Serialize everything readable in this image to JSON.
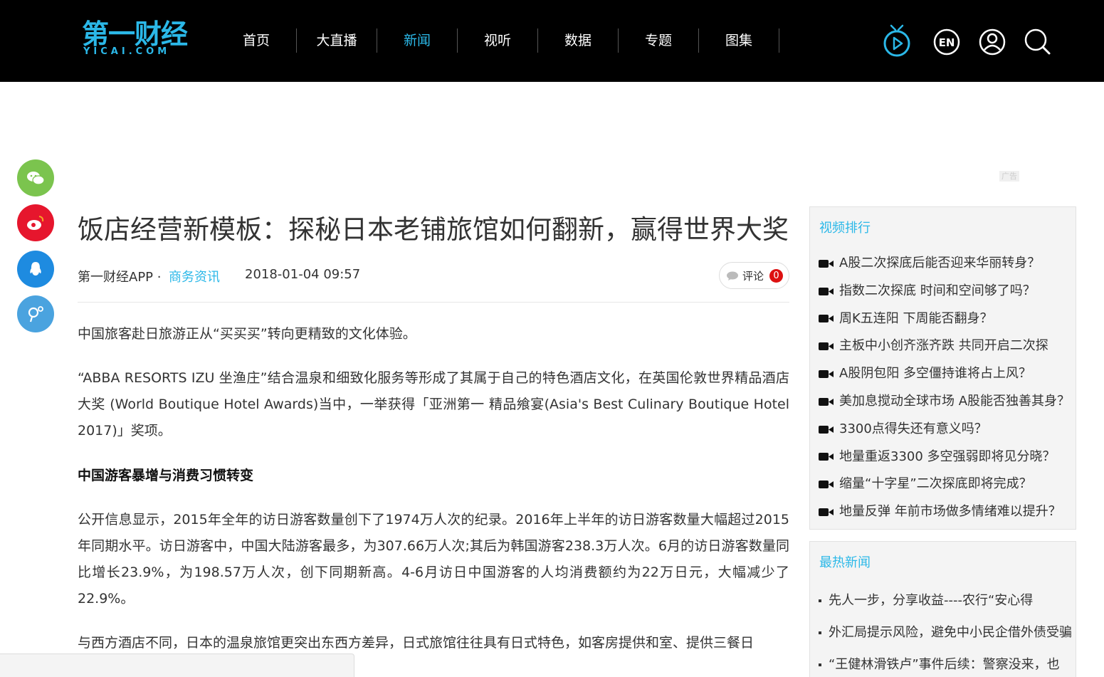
{
  "header": {
    "logo_cn": "第一财经",
    "logo_en": "YICAI.COM",
    "nav": [
      {
        "label": "首页",
        "active": false
      },
      {
        "label": "大直播",
        "active": false
      },
      {
        "label": "新闻",
        "active": true
      },
      {
        "label": "视听",
        "active": false
      },
      {
        "label": "数据",
        "active": false
      },
      {
        "label": "专题",
        "active": false
      },
      {
        "label": "图集",
        "active": false
      }
    ],
    "icons": [
      "tv-play-icon",
      "en-language-icon",
      "user-icon",
      "search-icon"
    ],
    "en_label": "EN"
  },
  "ad": {
    "tag": "广告"
  },
  "share": [
    {
      "name": "wechat-share-icon",
      "color": "#7bc44e"
    },
    {
      "name": "weibo-share-icon",
      "color": "#e6162d"
    },
    {
      "name": "qq-share-icon",
      "color": "#1e8be0"
    },
    {
      "name": "qzone-share-icon",
      "color": "#4aa3df"
    }
  ],
  "article": {
    "title": "饭店经营新模板：探秘日本老铺旅馆如何翻新，赢得世界大奖",
    "source": "第一财经APP ·",
    "category": "商务资讯",
    "date": "2018-01-04 09:57",
    "comment_label": "评论",
    "comment_count": "0",
    "paragraphs": [
      "中国旅客赴日旅游正从“买买买”转向更精致的文化体验。",
      "“ABBA RESORTS IZU 坐渔庄”结合温泉和细致化服务等形成了其属于自己的特色酒店文化，在英国伦敦世界精品酒店大奖 (World Boutique Hotel Awards)当中，一举获得「亚洲第一 精品飨宴(Asia's Best Culinary Boutique Hotel 2017)」奖项。"
    ],
    "subheading": "中国游客暴增与消费习惯转变",
    "paragraph3": "公开信息显示，2015年全年的访日游客数量创下了1974万人次的纪录。2016年上半年的访日游客数量大幅超过2015年同期水平。访日游客中，中国大陆游客最多，为307.66万人次;其后为韩国游客238.3万人次。6月的访日游客数量同比增长23.9%，为198.57万人次，创下同期新高。4-6月访日中国游客的人均消费额约为22万日元，大幅减少了22.9%。",
    "paragraph4": "与西方酒店不同，日本的温泉旅馆更突出东西方差异，日式旅馆往往具有日式特色，如客房提供和室、提供三餐日"
  },
  "sidebar": {
    "video_title": "视频排行",
    "videos": [
      "A股二次探底后能否迎来华丽转身？",
      "指数二次探底 时间和空间够了吗？",
      "周K五连阳 下周能否翻身？",
      "主板中小创齐涨齐跌 共同开启二次探",
      "A股阴包阳 多空僵持谁将占上风？",
      "美加息搅动全球市场 A股能否独善其身？",
      "3300点得失还有意义吗？",
      "地量重返3300 多空强弱即将见分晓？",
      "缩量“十字星”二次探底即将完成？",
      "地量反弹 年前市场做多情绪难以提升？"
    ],
    "news_title": "最热新闻",
    "news": [
      "先人一步，分享收益----农行“安心得",
      "外汇局提示风险，避免中小民企借外债受骗",
      "“王健林滑铁卢”事件后续：警察没来，也"
    ]
  }
}
